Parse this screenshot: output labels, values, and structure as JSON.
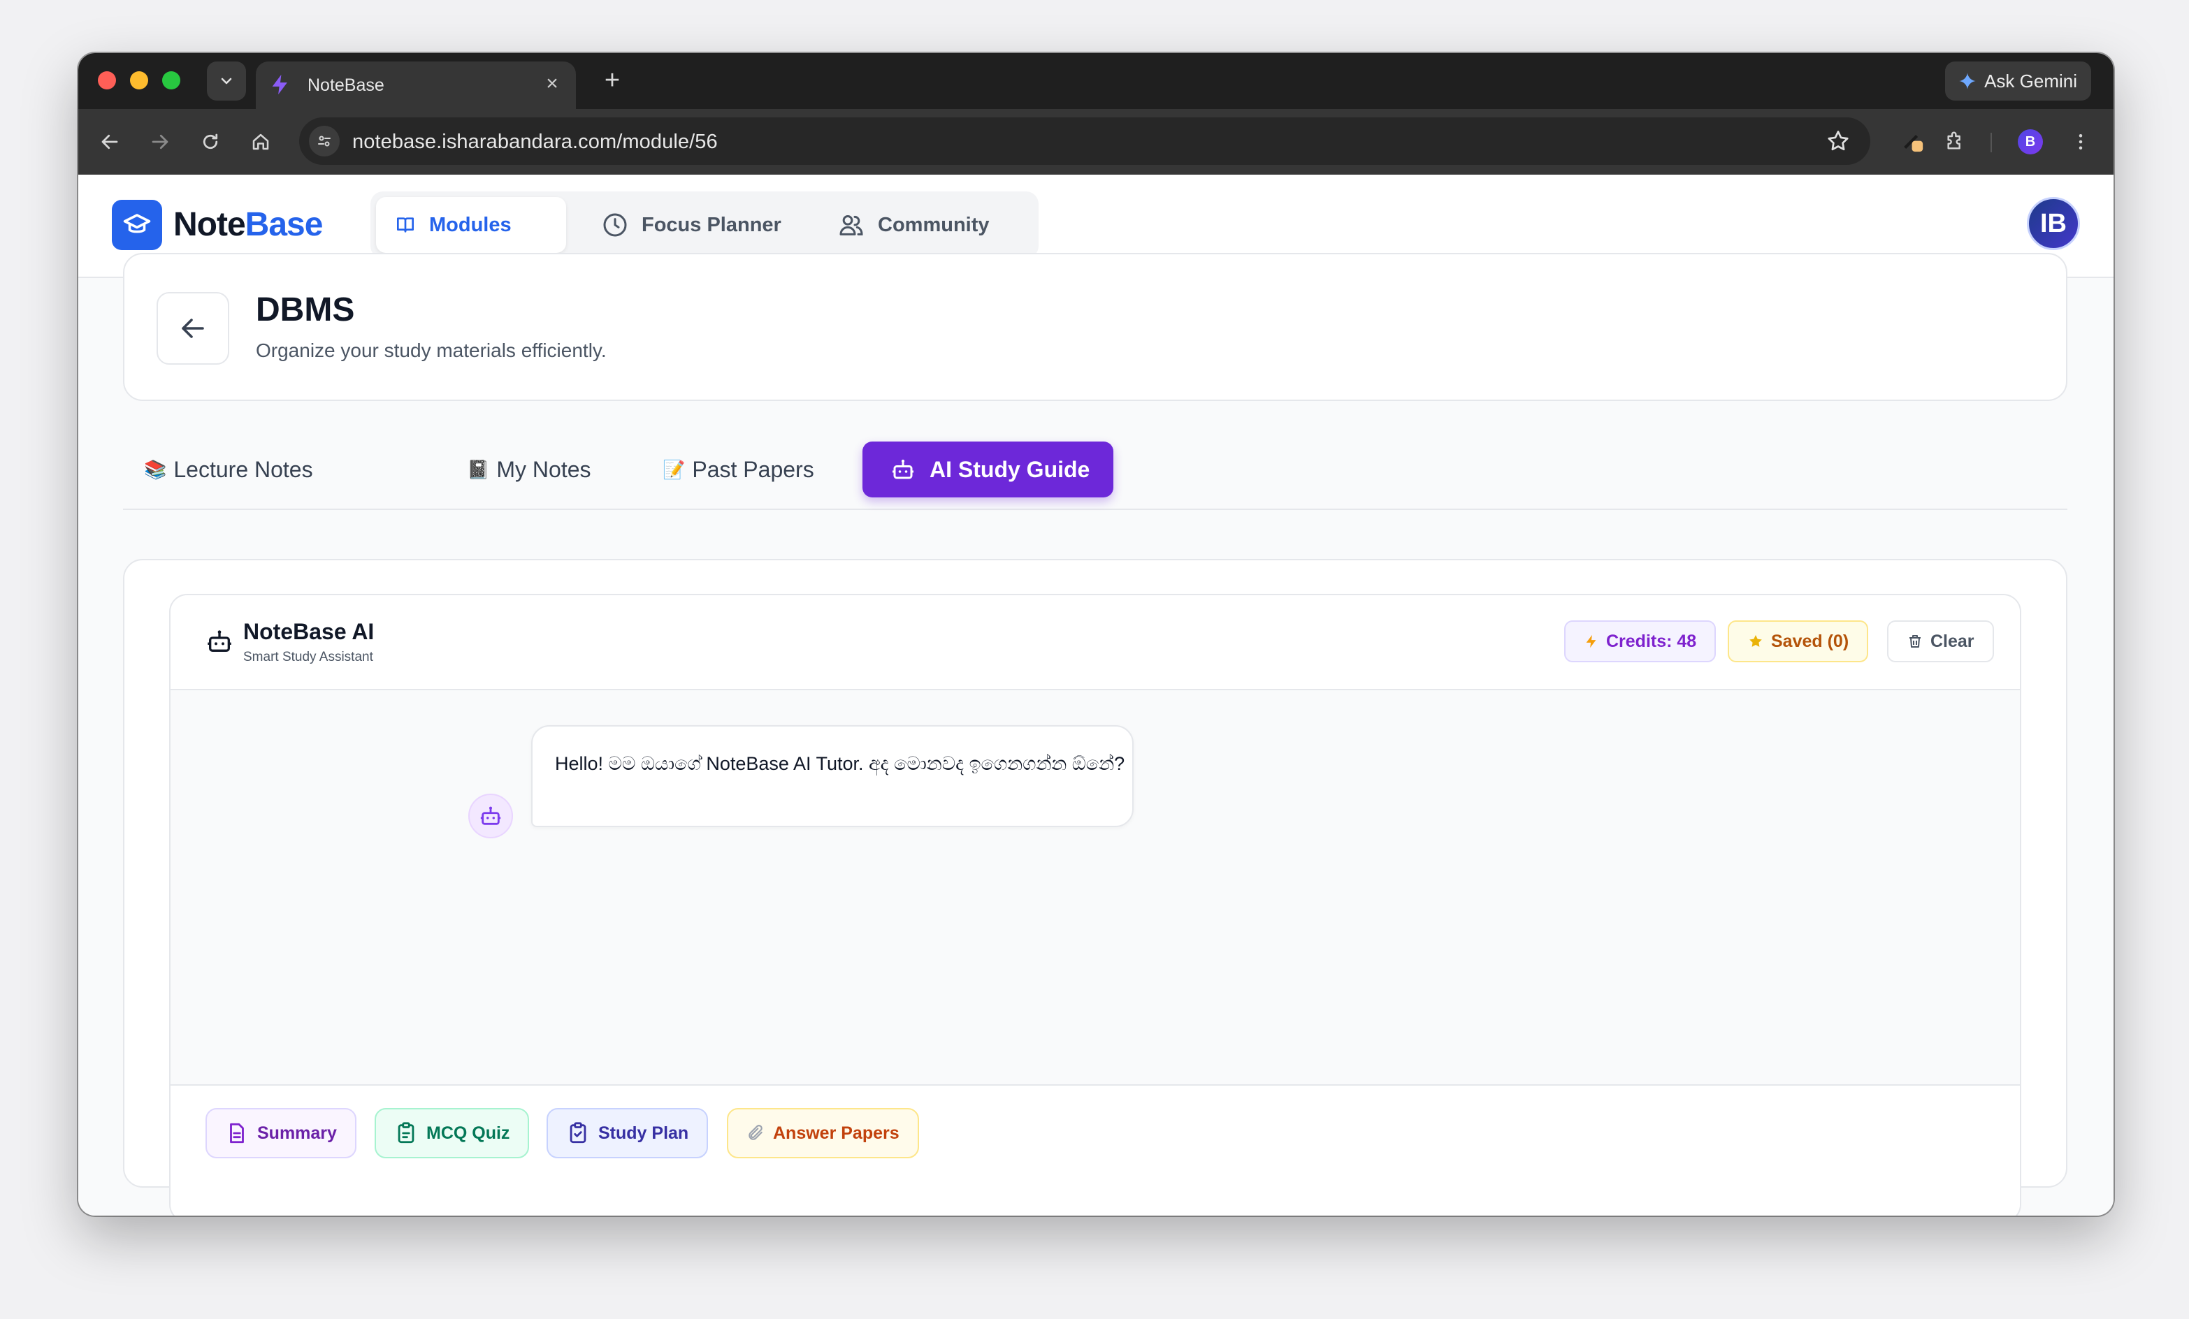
{
  "browser": {
    "tab_title": "NoteBase",
    "new_tab": "+",
    "close": "×",
    "gemini_label": "Ask Gemini",
    "url": "notebase.isharabandara.com/module/56",
    "profile_initial": "B"
  },
  "app": {
    "logo_part1": "Note",
    "logo_part2": "Base",
    "nav": [
      {
        "label": "Modules",
        "active": true
      },
      {
        "label": "Focus Planner",
        "active": false
      },
      {
        "label": "Community",
        "active": false
      }
    ],
    "avatar_initial": "IB"
  },
  "module": {
    "title": "DBMS",
    "subtitle": "Organize your study materials efficiently."
  },
  "tabs": [
    {
      "emoji": "📚",
      "label": "Lecture Notes"
    },
    {
      "emoji": "📓",
      "label": "My Notes"
    },
    {
      "emoji": "📝",
      "label": "Past Papers"
    },
    {
      "emoji": "",
      "label": "AI Study Guide",
      "active": true
    }
  ],
  "assistant": {
    "name": "NoteBase AI",
    "subtitle": "Smart Study Assistant",
    "credits": "Credits: 48",
    "saved": "Saved (0)",
    "clear": "Clear",
    "greeting": "Hello! මම ඔයාගේ NoteBase AI Tutor. අද මොනවද ඉගෙනගන්න ඕනේ?"
  },
  "quick_actions": [
    {
      "label": "Summary"
    },
    {
      "label": "MCQ Quiz"
    },
    {
      "label": "Study Plan"
    },
    {
      "label": "Answer Papers"
    }
  ],
  "colors": {
    "brand_blue": "#2563eb",
    "ai_purple": "#6d28d9"
  }
}
